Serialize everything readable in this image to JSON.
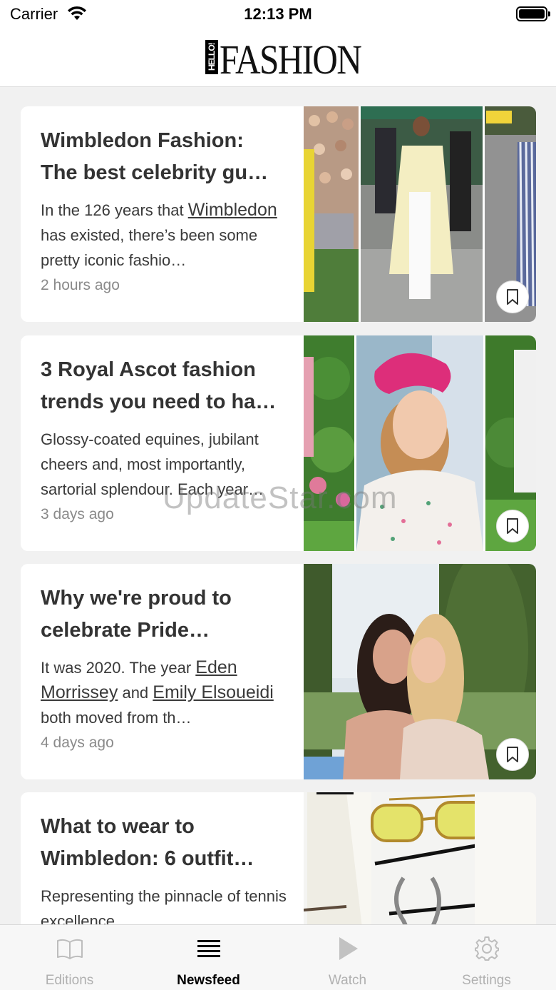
{
  "status_bar": {
    "carrier": "Carrier",
    "time": "12:13 PM"
  },
  "header": {
    "logo_hello": "HELLO!",
    "logo_main": "FASHION"
  },
  "articles": [
    {
      "title_line1": "Wimbledon Fashion:",
      "title_line2": "The best celebrity gu…",
      "excerpt_pre": "In the 126 years that ",
      "excerpt_link1": "Wimbledon",
      "excerpt_post": " has existed, there’s been some pretty iconic fashio…",
      "time": "2 hours ago"
    },
    {
      "title_line1": "3 Royal Ascot fashion",
      "title_line2": "trends you need to ha…",
      "excerpt_pre": "Glossy-coated equines, jubilant cheers and, most importantly, sartorial splendour. Each year…",
      "time": "3 days ago"
    },
    {
      "title_line1": "Why we're proud to",
      "title_line2": "celebrate Pride…",
      "excerpt_pre": "It was 2020. The year ",
      "excerpt_link1": "Eden Morrissey",
      "excerpt_mid": " and ",
      "excerpt_link2": "Emily Elsoueidi",
      "excerpt_post": " both moved from th…",
      "time": "4 days ago"
    },
    {
      "title_line1": "What to wear to",
      "title_line2": "Wimbledon: 6 outfit…",
      "excerpt_pre": "Representing the pinnacle of tennis excellence…"
    }
  ],
  "watermark": "UpdateStar.com",
  "tabs": [
    {
      "label": "Editions",
      "icon": "book-icon",
      "active": false
    },
    {
      "label": "Newsfeed",
      "icon": "newsfeed-icon",
      "active": true
    },
    {
      "label": "Watch",
      "icon": "play-icon",
      "active": false
    },
    {
      "label": "Settings",
      "icon": "gear-icon",
      "active": false
    }
  ]
}
